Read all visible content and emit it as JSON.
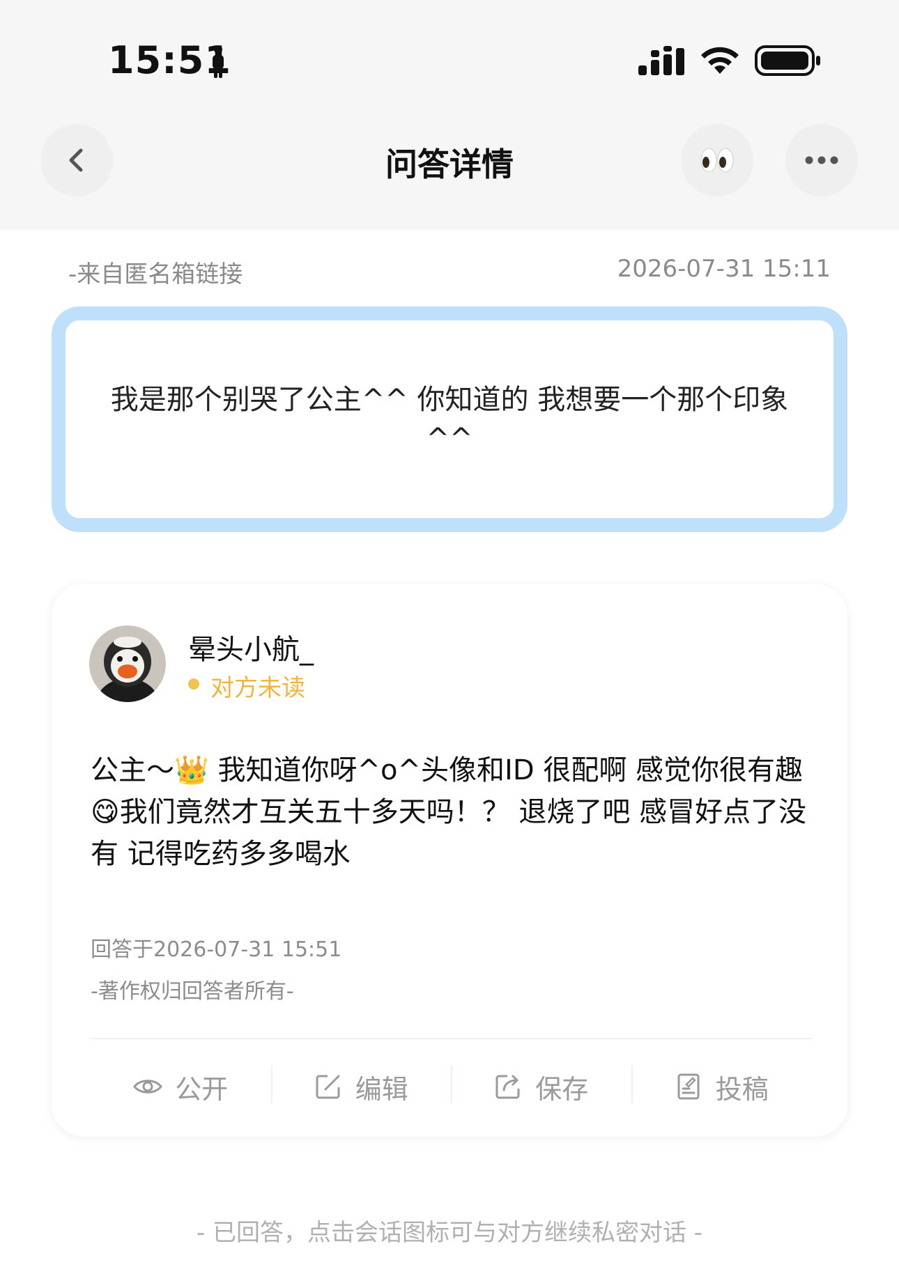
{
  "status_bar": {
    "time": "15:51"
  },
  "nav": {
    "title": "问答详情",
    "icons": [
      "back-chevron-icon",
      "eyes-emoji-icon",
      "more-dots-icon"
    ]
  },
  "question": {
    "source": "-来自匿名箱链接",
    "timestamp": "2026-07-31 15:11",
    "text": "我是那个别哭了公主^^ 你知道的 我想要一个那个印象 ^^",
    "border_color": "#bfe0fb"
  },
  "answer": {
    "username": "晕头小航_",
    "read_status": "对方未读",
    "status_color": "#f5c34b",
    "text_part1": "公主～",
    "emoji_crown": "👑",
    "text_part2": " 我知道你呀^o^头像和ID 很配啊 感觉你很有趣",
    "emoji_yum": "😋",
    "text_part3": "我们竟然才互关五十多天吗！？ 退烧了吧 感冒好点了没有 记得吃药多多喝水",
    "answered_at": "回答于2026-07-31 15:51",
    "copyright": "-著作权归回答者所有-"
  },
  "actions": {
    "public_label": "公开",
    "edit_label": "编辑",
    "save_label": "保存",
    "submit_label": "投稿"
  },
  "footer": {
    "note": "- 已回答，点击会话图标可与对方继续私密对话 -"
  }
}
